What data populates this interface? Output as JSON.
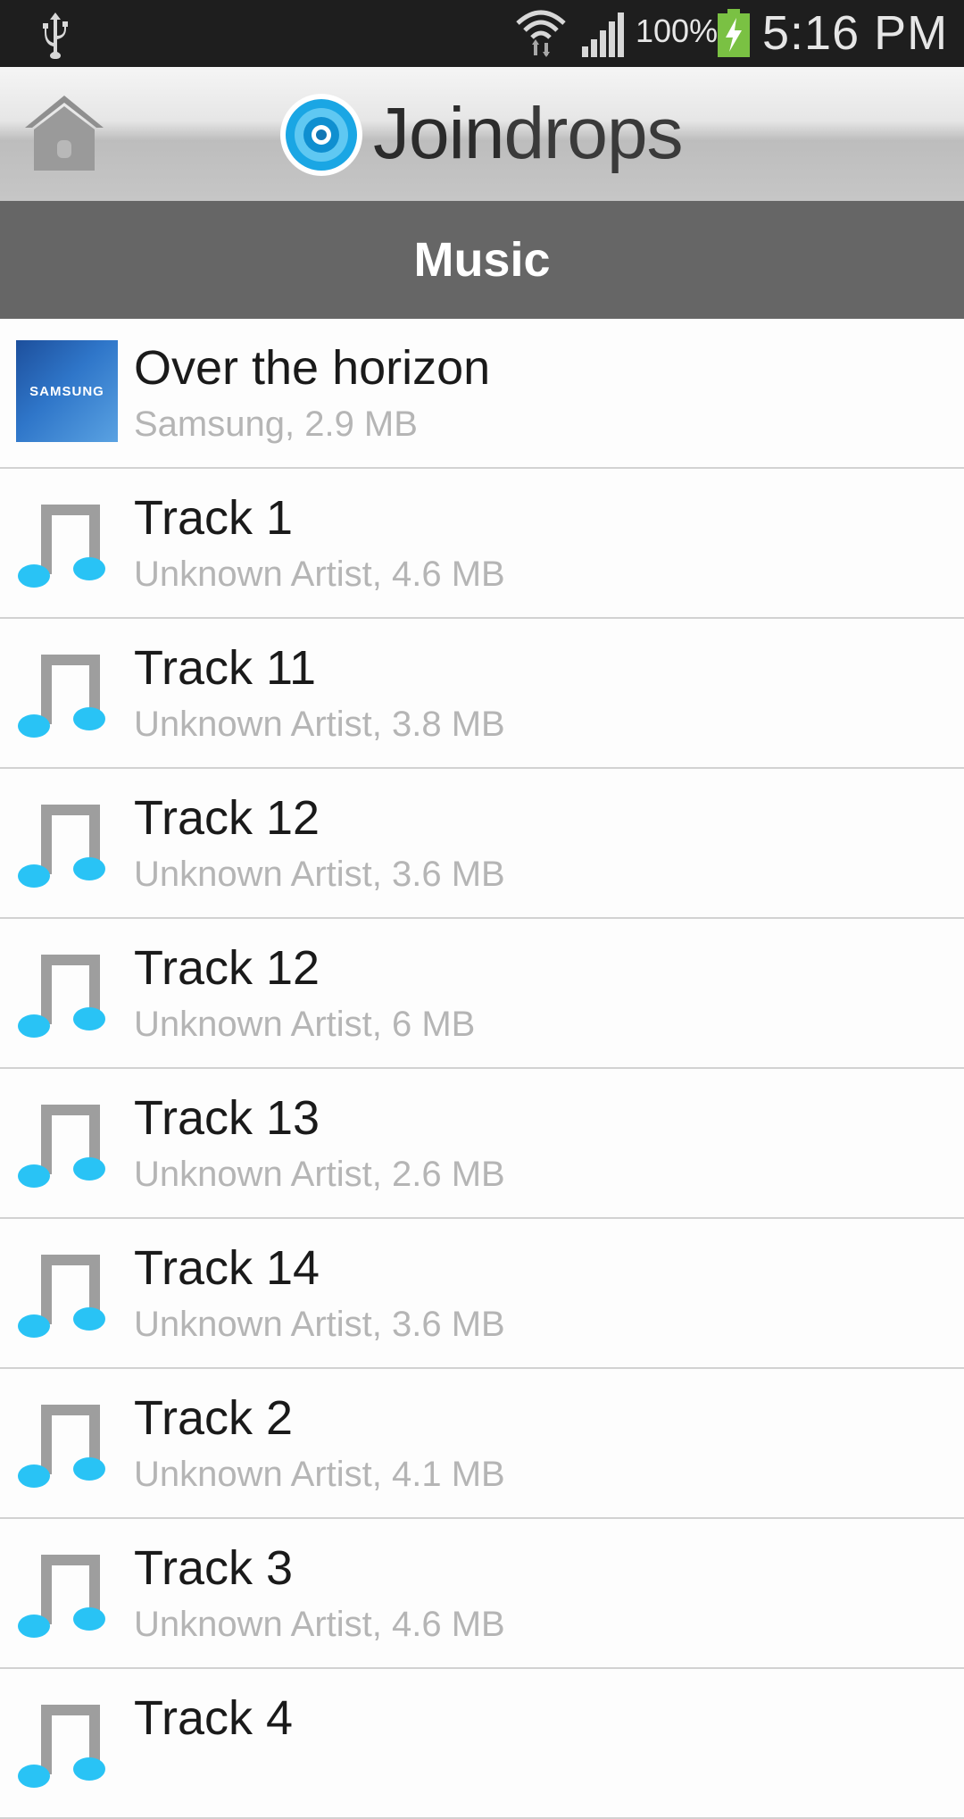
{
  "status_bar": {
    "battery_percent": "100%",
    "time": "5:16 PM",
    "icons": [
      "usb-icon",
      "wifi-icon",
      "signal-icon",
      "battery-charging-icon"
    ]
  },
  "header": {
    "app_name_bold": "Join",
    "app_name_light": "drops",
    "home_icon": "home-icon",
    "logo_icon": "joindrops-logo-icon"
  },
  "section": {
    "title": "Music"
  },
  "tracks": [
    {
      "title": "Over the horizon",
      "subtitle": "Samsung, 2.9 MB",
      "thumb": "album-art",
      "thumb_label": "SAMSUNG"
    },
    {
      "title": "Track 1",
      "subtitle": "Unknown Artist, 4.6 MB",
      "thumb": "music-note-icon"
    },
    {
      "title": "Track 11",
      "subtitle": "Unknown Artist, 3.8 MB",
      "thumb": "music-note-icon"
    },
    {
      "title": "Track 12",
      "subtitle": "Unknown Artist, 3.6 MB",
      "thumb": "music-note-icon"
    },
    {
      "title": "Track 12",
      "subtitle": "Unknown Artist, 6 MB",
      "thumb": "music-note-icon"
    },
    {
      "title": "Track 13",
      "subtitle": "Unknown Artist, 2.6 MB",
      "thumb": "music-note-icon"
    },
    {
      "title": "Track 14",
      "subtitle": "Unknown Artist, 3.6 MB",
      "thumb": "music-note-icon"
    },
    {
      "title": "Track 2",
      "subtitle": "Unknown Artist, 4.1 MB",
      "thumb": "music-note-icon"
    },
    {
      "title": "Track 3",
      "subtitle": "Unknown Artist, 4.6 MB",
      "thumb": "music-note-icon"
    },
    {
      "title": "Track 4",
      "subtitle": "",
      "thumb": "music-note-icon"
    }
  ],
  "colors": {
    "status_bar_bg": "#1e1e1e",
    "section_bar_bg": "#666666",
    "note_accent": "#29c3f5",
    "note_stem": "#9e9e9e",
    "subtitle_text": "#b5b5b5"
  }
}
